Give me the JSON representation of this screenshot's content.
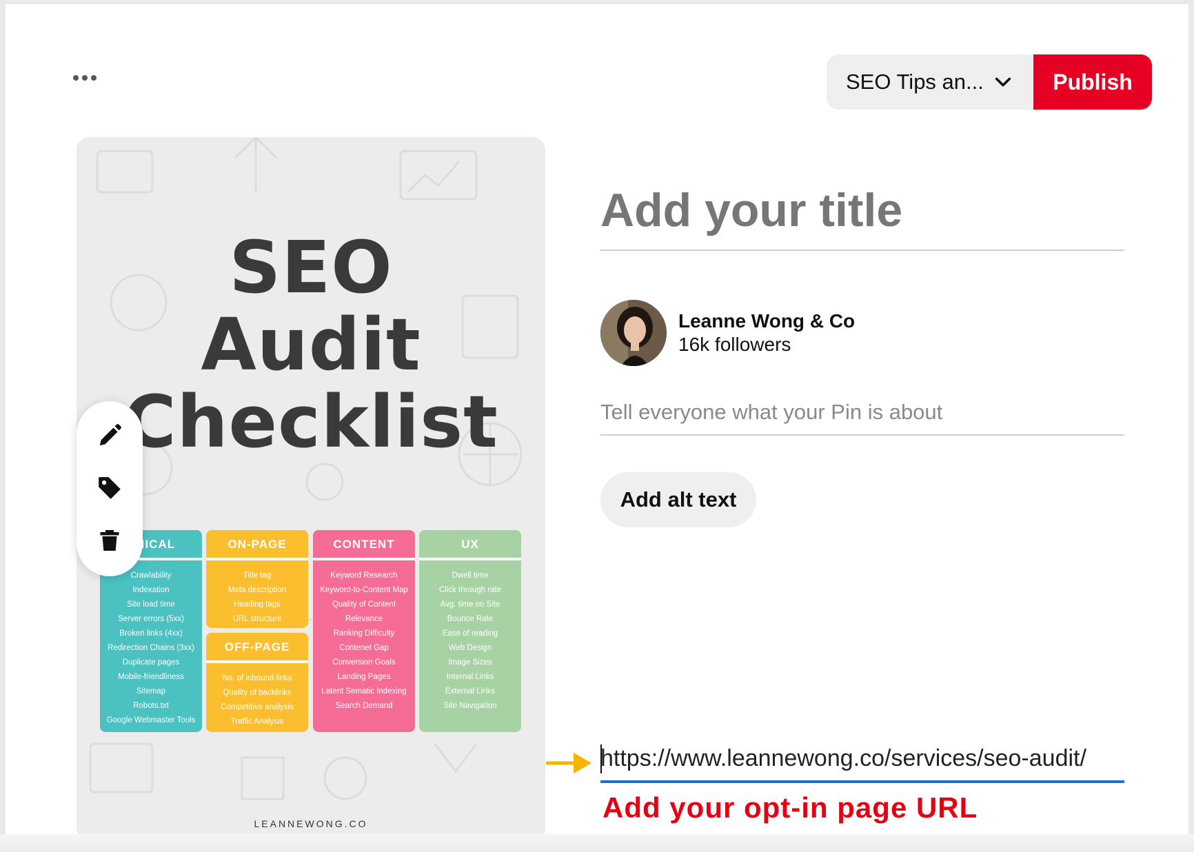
{
  "toolbar": {
    "board_select": "SEO Tips an...",
    "publish_label": "Publish",
    "accent_color": "#e60023"
  },
  "pin_image": {
    "title_line1": "SEO",
    "title_line2": "Audit",
    "title_line3": "Checklist",
    "footer": "LEANNEWONG.CO",
    "columns": {
      "technical": {
        "heading": "HNICAL",
        "items": [
          "Crawlability",
          "Indexation",
          "Site load time",
          "Server errors (5xx)",
          "Broken links (4xx)",
          "Redirection Chains (3xx)",
          "Duplicate pages",
          "Mobile-friendliness",
          "Sitemap",
          "Robots.txt",
          "Google Webmaster Tools"
        ]
      },
      "onpage": {
        "heading": "ON-PAGE",
        "items": [
          "Title tag",
          "Meta description",
          "Heading tags",
          "URL structure"
        ]
      },
      "offpage": {
        "heading": "OFF-PAGE",
        "items": [
          "No. of inbound links",
          "Quality of backlinks",
          "Competitive analysis",
          "Traffic Analysis"
        ]
      },
      "content": {
        "heading": "CONTENT",
        "items": [
          "Keyword Research",
          "Keyword-to-Content Map",
          "Quality of Content",
          "Relevance",
          "Ranking Difficulty",
          "Contenet Gap",
          "Conversion Goals",
          "Landing Pages",
          "Latent Sematic Indexing",
          "Search Demand"
        ]
      },
      "ux": {
        "heading": "UX",
        "items": [
          "Dwell time",
          "Click through rate",
          "Avg. time on Site",
          "Bounce Rate",
          "Ease of reading",
          "Web Design",
          "Image Sizes",
          "Internal Links",
          "External Links",
          "Site Navigation"
        ]
      }
    }
  },
  "tools": {
    "edit_icon": "pencil-icon",
    "tag_icon": "tag-icon",
    "delete_icon": "trash-icon"
  },
  "form": {
    "title_placeholder": "Add your title",
    "profile_name": "Leanne Wong & Co",
    "profile_followers": "16k followers",
    "description_placeholder": "Tell everyone what your Pin is about",
    "alt_text_label": "Add alt text",
    "url_value": "https://www.leannewong.co/services/seo-audit/"
  },
  "annotation": {
    "text": "Add your opt-in page URL",
    "color": "#e60012",
    "arrow_color": "#f6b400"
  }
}
